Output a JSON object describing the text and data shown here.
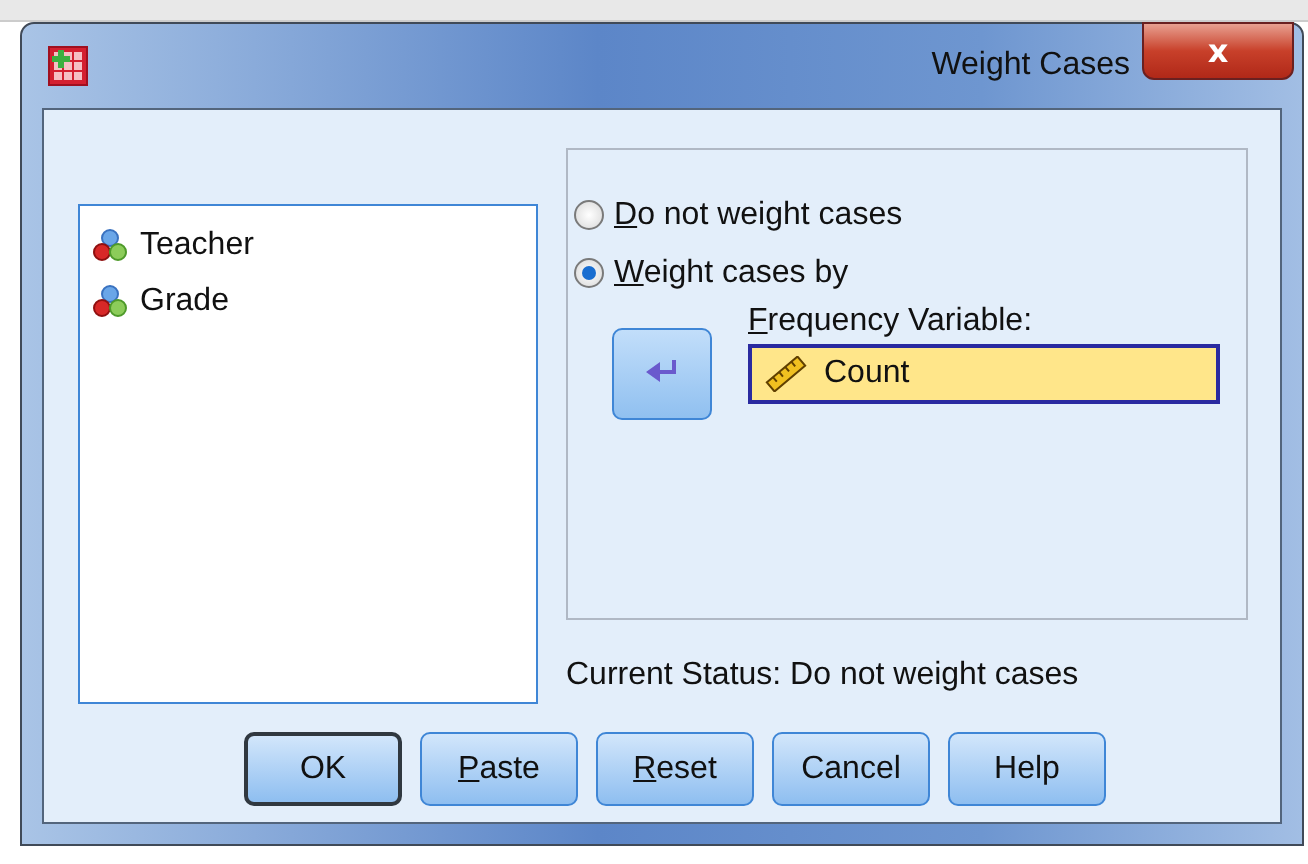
{
  "window": {
    "title": "Weight Cases",
    "close_label": "x"
  },
  "variables": [
    {
      "name": "Teacher",
      "selected": false
    },
    {
      "name": "Grade",
      "selected": false
    }
  ],
  "options": [
    {
      "label": "Do not weight cases",
      "underline_first": true,
      "selected": false
    },
    {
      "label": "Weight cases by",
      "underline_first": true,
      "selected": true
    }
  ],
  "frequency_variable": {
    "label": "Frequency Variable:",
    "underline_first": true,
    "value": "Count"
  },
  "status": "Current Status: Do not weight cases",
  "buttons": [
    {
      "label": "OK",
      "underline_first": false,
      "default": true
    },
    {
      "label": "Paste",
      "underline_first": true,
      "default": false
    },
    {
      "label": "Reset",
      "underline_first": true,
      "default": false
    },
    {
      "label": "Cancel",
      "underline_first": false,
      "default": false
    },
    {
      "label": "Help",
      "underline_first": false,
      "default": false
    }
  ]
}
